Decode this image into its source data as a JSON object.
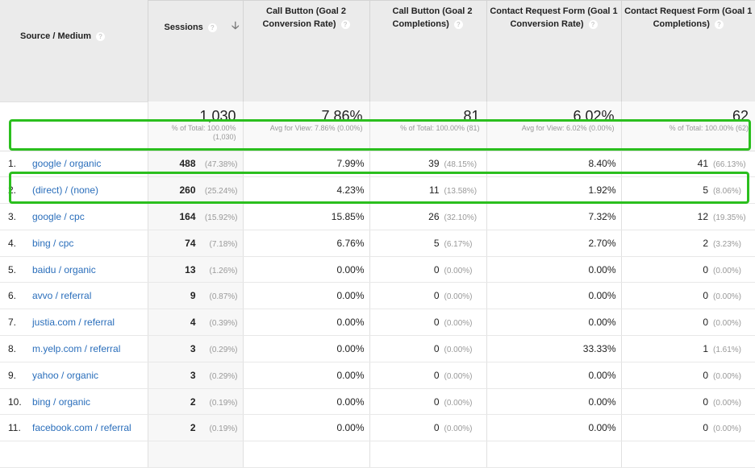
{
  "table": {
    "dimension_header": "Source / Medium",
    "sort_icon": "arrow-down-icon",
    "help_icon": "help-circle-icon",
    "columns": [
      {
        "label": "Sessions",
        "sorted": true
      },
      {
        "label": "Call Button (Goal 2 Conversion Rate)"
      },
      {
        "label": "Call Button (Goal 2 Completions)"
      },
      {
        "label": "Contact Request Form (Goal 1 Conversion Rate)"
      },
      {
        "label": "Contact Request Form (Goal 1 Completions)"
      }
    ],
    "column_labels_wrapped": [
      {
        "line1": "Sessions",
        "line2": ""
      },
      {
        "line1": "Call Button (Goal 2",
        "line2": "Conversion Rate)"
      },
      {
        "line1": "Call Button (Goal 2",
        "line2": "Completions)"
      },
      {
        "line1": "Contact Request Form (Goal 1",
        "line2": "Conversion Rate)"
      },
      {
        "line1": "Contact Request Form (Goal 1",
        "line2": "Completions)"
      }
    ],
    "totals": [
      {
        "value": "1,030",
        "sub": "% of Total: 100.00%",
        "sub2": "(1,030)"
      },
      {
        "value": "7.86%",
        "sub": "Avg for View: 7.86% (0.00%)",
        "sub2": ""
      },
      {
        "value": "81",
        "sub": "% of Total: 100.00% (81)",
        "sub2": ""
      },
      {
        "value": "6.02%",
        "sub": "Avg for View: 6.02% (0.00%)",
        "sub2": ""
      },
      {
        "value": "62",
        "sub": "% of Total: 100.00% (62)",
        "sub2": ""
      }
    ],
    "rows": [
      {
        "index": "1.",
        "source": "google / organic",
        "sessions": "488",
        "sessions_pct": "(47.38%)",
        "call_rate": "7.99%",
        "call_compl": "39",
        "call_compl_pct": "(48.15%)",
        "form_rate": "8.40%",
        "form_compl": "41",
        "form_compl_pct": "(66.13%)",
        "highlighted": true
      },
      {
        "index": "2.",
        "source": "(direct) / (none)",
        "sessions": "260",
        "sessions_pct": "(25.24%)",
        "call_rate": "4.23%",
        "call_compl": "11",
        "call_compl_pct": "(13.58%)",
        "form_rate": "1.92%",
        "form_compl": "5",
        "form_compl_pct": "(8.06%)",
        "highlighted": false
      },
      {
        "index": "3.",
        "source": "google / cpc",
        "sessions": "164",
        "sessions_pct": "(15.92%)",
        "call_rate": "15.85%",
        "call_compl": "26",
        "call_compl_pct": "(32.10%)",
        "form_rate": "7.32%",
        "form_compl": "12",
        "form_compl_pct": "(19.35%)",
        "highlighted": true
      },
      {
        "index": "4.",
        "source": "bing / cpc",
        "sessions": "74",
        "sessions_pct": "(7.18%)",
        "call_rate": "6.76%",
        "call_compl": "5",
        "call_compl_pct": "(6.17%)",
        "form_rate": "2.70%",
        "form_compl": "2",
        "form_compl_pct": "(3.23%)",
        "highlighted": false
      },
      {
        "index": "5.",
        "source": "baidu / organic",
        "sessions": "13",
        "sessions_pct": "(1.26%)",
        "call_rate": "0.00%",
        "call_compl": "0",
        "call_compl_pct": "(0.00%)",
        "form_rate": "0.00%",
        "form_compl": "0",
        "form_compl_pct": "(0.00%)",
        "highlighted": false
      },
      {
        "index": "6.",
        "source": "avvo / referral",
        "sessions": "9",
        "sessions_pct": "(0.87%)",
        "call_rate": "0.00%",
        "call_compl": "0",
        "call_compl_pct": "(0.00%)",
        "form_rate": "0.00%",
        "form_compl": "0",
        "form_compl_pct": "(0.00%)",
        "highlighted": false
      },
      {
        "index": "7.",
        "source": "justia.com / referral",
        "sessions": "4",
        "sessions_pct": "(0.39%)",
        "call_rate": "0.00%",
        "call_compl": "0",
        "call_compl_pct": "(0.00%)",
        "form_rate": "0.00%",
        "form_compl": "0",
        "form_compl_pct": "(0.00%)",
        "highlighted": false
      },
      {
        "index": "8.",
        "source": "m.yelp.com / referral",
        "sessions": "3",
        "sessions_pct": "(0.29%)",
        "call_rate": "0.00%",
        "call_compl": "0",
        "call_compl_pct": "(0.00%)",
        "form_rate": "33.33%",
        "form_compl": "1",
        "form_compl_pct": "(1.61%)",
        "highlighted": false
      },
      {
        "index": "9.",
        "source": "yahoo / organic",
        "sessions": "3",
        "sessions_pct": "(0.29%)",
        "call_rate": "0.00%",
        "call_compl": "0",
        "call_compl_pct": "(0.00%)",
        "form_rate": "0.00%",
        "form_compl": "0",
        "form_compl_pct": "(0.00%)",
        "highlighted": false
      },
      {
        "index": "10.",
        "source": "bing / organic",
        "sessions": "2",
        "sessions_pct": "(0.19%)",
        "call_rate": "0.00%",
        "call_compl": "0",
        "call_compl_pct": "(0.00%)",
        "form_rate": "0.00%",
        "form_compl": "0",
        "form_compl_pct": "(0.00%)",
        "highlighted": false
      },
      {
        "index": "11.",
        "source": "facebook.com / referral",
        "sessions": "2",
        "sessions_pct": "(0.19%)",
        "call_rate": "0.00%",
        "call_compl": "0",
        "call_compl_pct": "(0.00%)",
        "form_rate": "0.00%",
        "form_compl": "0",
        "form_compl_pct": "(0.00%)",
        "highlighted": false
      }
    ]
  },
  "colors": {
    "link": "#2a6ebb",
    "highlight_border": "#2bbf1e",
    "header_bg": "#ebebeb",
    "sorted_col_bg": "#f7f7f7"
  }
}
